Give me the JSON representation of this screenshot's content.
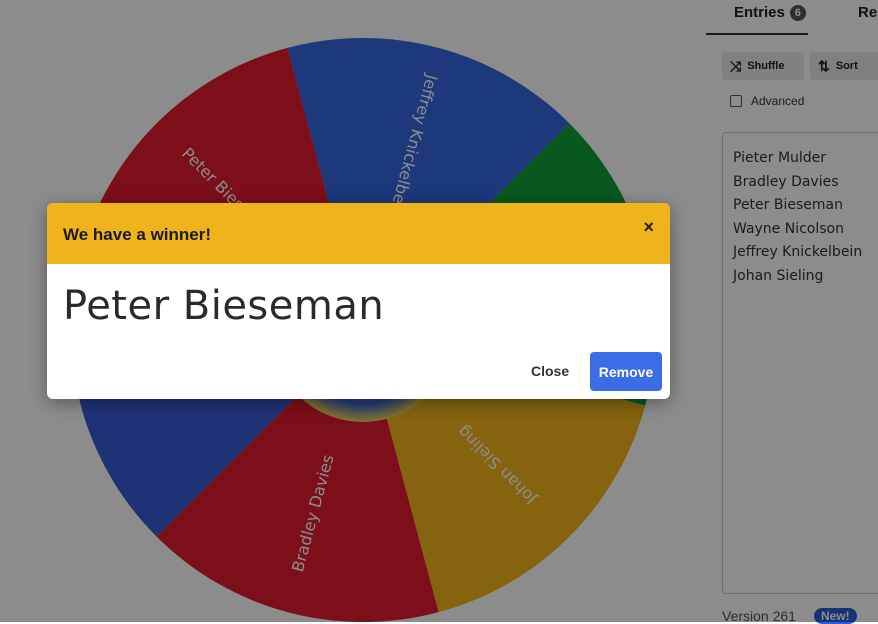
{
  "wheel": {
    "segments": [
      {
        "label": "Jeffrey Knickelbe...",
        "color": "#3568e2"
      },
      {
        "label": "Wayne Nicolson",
        "color": "#0fa23a"
      },
      {
        "label": "Johan Sieling",
        "color": "#f2b51d"
      },
      {
        "label": "Bradley Davies",
        "color": "#e41d30"
      },
      {
        "label": "Pieter Mulder",
        "color": "#3a5bd8"
      },
      {
        "label": "Peter Bieseman",
        "color": "#e41d30"
      }
    ]
  },
  "panel": {
    "tab_entries": "Entries",
    "tab_entries_count": "6",
    "tab_results": "Re",
    "shuffle_label": "Shuffle",
    "sort_label": "Sort",
    "advanced_label": "Advanced",
    "entries": [
      "Pieter Mulder",
      "Bradley Davies",
      "Peter Bieseman",
      "Wayne Nicolson",
      "Jeffrey Knickelbein",
      "Johan Sieling"
    ],
    "version": "Version 261",
    "new_badge": "New!"
  },
  "modal": {
    "title": "We have a winner!",
    "close_x": "×",
    "winner": "Peter Bieseman",
    "close_label": "Close",
    "remove_label": "Remove"
  }
}
